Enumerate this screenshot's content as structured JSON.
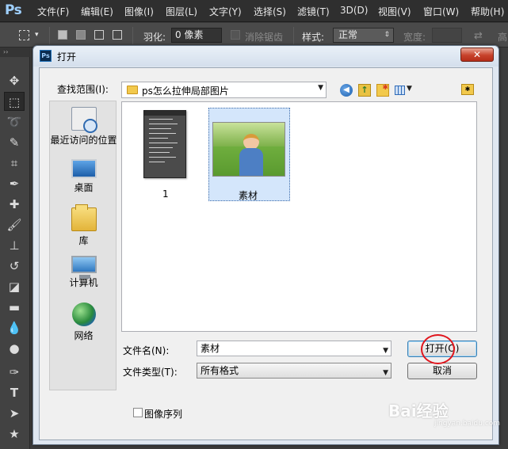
{
  "ps": {
    "logo": "Ps",
    "menu": [
      "文件(F)",
      "编辑(E)",
      "图像(I)",
      "图层(L)",
      "文字(Y)",
      "选择(S)",
      "滤镜(T)",
      "3D(D)",
      "视图(V)",
      "窗口(W)",
      "帮助(H)"
    ],
    "options": {
      "feather_label": "羽化:",
      "feather_value": "0 像素",
      "antialias_label": "消除锯齿",
      "style_label": "样式:",
      "style_value": "正常",
      "width_label": "宽度:",
      "height_label": "高"
    },
    "toolbar_grip": "››"
  },
  "dialog": {
    "app_icon": "Ps",
    "title": "打开",
    "close_label": "✕",
    "lookin_label": "查找范围(I):",
    "lookin_value": "ps怎么拉伸局部图片",
    "places": [
      {
        "label": "最近访问的位置",
        "icon": "recent-places-icon"
      },
      {
        "label": "桌面",
        "icon": "desktop-icon"
      },
      {
        "label": "库",
        "icon": "library-icon"
      },
      {
        "label": "计算机",
        "icon": "computer-icon"
      },
      {
        "label": "网络",
        "icon": "network-icon"
      }
    ],
    "files": [
      {
        "name": "1",
        "selected": false
      },
      {
        "name": "素材",
        "selected": true
      }
    ],
    "filename_label": "文件名(N):",
    "filename_value": "素材",
    "filetype_label": "文件类型(T):",
    "filetype_value": "所有格式",
    "open_button": "打开(O)",
    "cancel_button": "取消",
    "image_sequence_label": "图像序列"
  },
  "watermark": {
    "brand": "Bai经验",
    "sub": "jingyan.baidu.com"
  },
  "colors": {
    "ps_bg": "#3c3c3c",
    "dialog_bg": "#f0f0f0",
    "close_red": "#c7422b",
    "highlight_circle": "#e0141c",
    "selection": "#d4e6fb"
  }
}
